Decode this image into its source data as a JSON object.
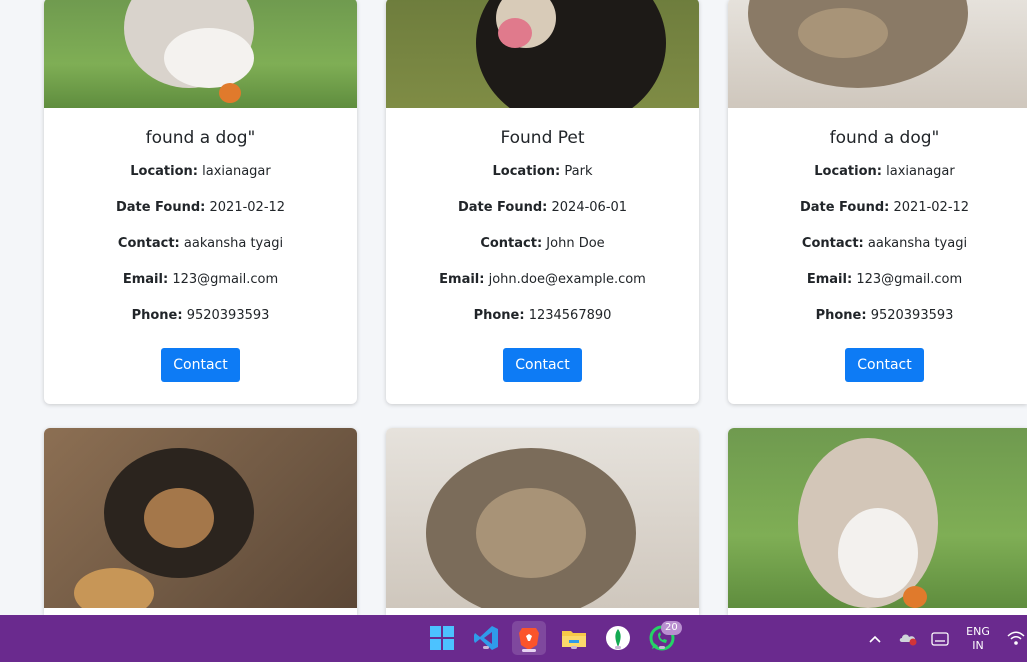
{
  "cards": [
    {
      "image": "rabbit-photo",
      "title": "found a dog\"",
      "fields": [
        {
          "label": "Location:",
          "value": "laxianagar"
        },
        {
          "label": "Date Found:",
          "value": "2021-02-12"
        },
        {
          "label": "Contact:",
          "value": "aakansha tyagi"
        },
        {
          "label": "Email:",
          "value": "123@gmail.com"
        },
        {
          "label": "Phone:",
          "value": "9520393593"
        }
      ],
      "button": "Contact"
    },
    {
      "image": "dog-photo",
      "title": "Found Pet",
      "fields": [
        {
          "label": "Location:",
          "value": "Park"
        },
        {
          "label": "Date Found:",
          "value": "2024-06-01"
        },
        {
          "label": "Contact:",
          "value": "John Doe"
        },
        {
          "label": "Email:",
          "value": "john.doe@example.com"
        },
        {
          "label": "Phone:",
          "value": "1234567890"
        }
      ],
      "button": "Contact"
    },
    {
      "image": "cat-photo",
      "title": "found a dog\"",
      "fields": [
        {
          "label": "Location:",
          "value": "laxianagar"
        },
        {
          "label": "Date Found:",
          "value": "2021-02-12"
        },
        {
          "label": "Contact:",
          "value": "aakansha tyagi"
        },
        {
          "label": "Email:",
          "value": "123@gmail.com"
        },
        {
          "label": "Phone:",
          "value": "9520393593"
        }
      ],
      "button": "Contact"
    }
  ],
  "second_row_images": [
    "puppy-photo",
    "cat-photo",
    "rabbit-photo"
  ],
  "colors": {
    "button": "#0d7bf5",
    "taskbar": "#6a2a8e"
  },
  "taskbar": {
    "apps": [
      "windows-start-icon",
      "vscode-icon",
      "brave-browser-icon",
      "file-explorer-icon",
      "mongodb-compass-icon",
      "whatsapp-icon"
    ],
    "whatsapp_badge": "20",
    "language": "ENG",
    "region": "IN"
  }
}
